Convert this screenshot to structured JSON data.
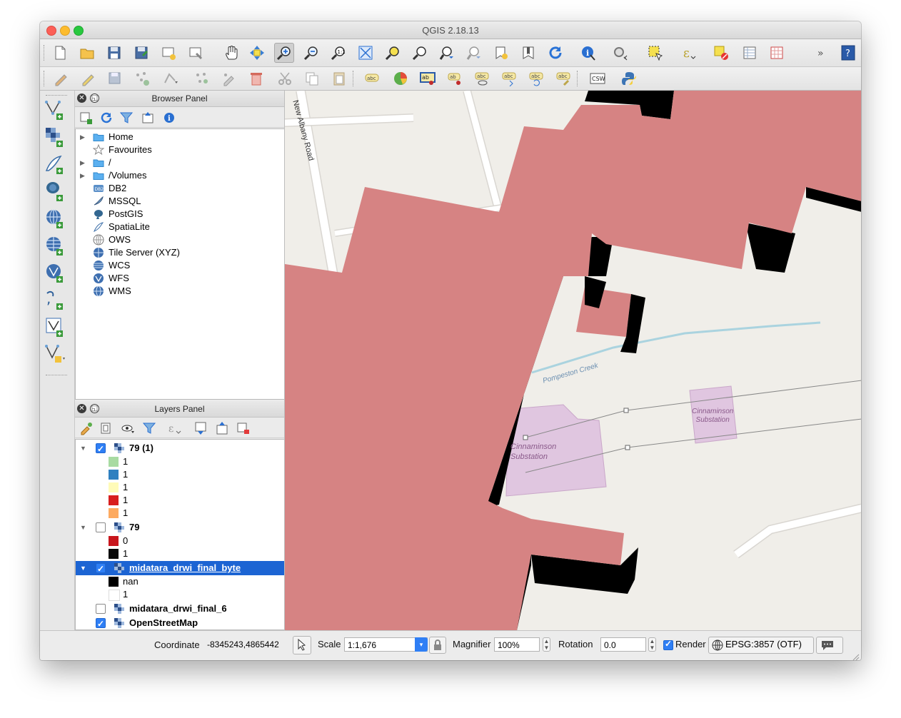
{
  "window": {
    "title": "QGIS 2.18.13"
  },
  "icons": {
    "toolbar1": [
      "new-project-icon",
      "open-project-icon",
      "save-project-icon",
      "save-as-icon",
      "new-print-composer-icon",
      "composer-manager-icon",
      "pan-icon",
      "pan-to-selection-icon",
      "zoom-in-icon",
      "zoom-out-icon",
      "zoom-native-icon",
      "zoom-full-icon",
      "zoom-to-selection-icon",
      "zoom-to-layer-icon",
      "zoom-last-icon",
      "zoom-next-icon",
      "new-bookmark-icon",
      "show-bookmarks-icon",
      "refresh-icon",
      "identify-icon",
      "run-action-icon",
      "select-features-icon",
      "field-calculator-icon",
      "deselect-icon",
      "attribute-table-icon",
      "statistics-icon",
      "overflow-chevron-icon",
      "help-icon"
    ],
    "toolbar2": [
      "current-edits-icon",
      "toggle-editing-icon",
      "save-edits-icon",
      "add-feature-icon",
      "move-feature-icon",
      "node-tool-icon",
      "digitize-icon",
      "delete-selected-icon",
      "cut-features-icon",
      "copy-features-icon",
      "paste-features-icon",
      "label-toolbar-icon",
      "layer-diagram-icon",
      "highlight-pinned-labels-icon",
      "pin-labels-icon",
      "show-hide-labels-icon",
      "move-label-icon",
      "rotate-label-icon",
      "change-label-icon",
      "csw-icon",
      "python-console-icon"
    ]
  },
  "left_toolbar": [
    "add-vector-layer-icon",
    "add-raster-layer-icon",
    "add-spatialite-layer-icon",
    "add-postgis-layer-icon",
    "add-wms-layer-icon",
    "add-wcs-layer-icon",
    "add-wfs-layer-icon",
    "add-delimited-text-icon",
    "add-virtual-layer-icon",
    "new-shapefile-icon"
  ],
  "browser_panel": {
    "title": "Browser Panel",
    "items": [
      {
        "label": "Home",
        "icon": "folder-icon",
        "expandable": true
      },
      {
        "label": "Favourites",
        "icon": "star-icon",
        "expandable": false
      },
      {
        "label": "/",
        "icon": "folder-icon",
        "expandable": true
      },
      {
        "label": "/Volumes",
        "icon": "folder-icon",
        "expandable": true
      },
      {
        "label": "DB2",
        "icon": "db2-icon",
        "expandable": false
      },
      {
        "label": "MSSQL",
        "icon": "mssql-icon",
        "expandable": false
      },
      {
        "label": "PostGIS",
        "icon": "postgis-icon",
        "expandable": false
      },
      {
        "label": "SpatiaLite",
        "icon": "spatialite-icon",
        "expandable": false
      },
      {
        "label": "OWS",
        "icon": "ows-icon",
        "expandable": false
      },
      {
        "label": "Tile Server (XYZ)",
        "icon": "xyz-icon",
        "expandable": false
      },
      {
        "label": "WCS",
        "icon": "wcs-icon",
        "expandable": false
      },
      {
        "label": "WFS",
        "icon": "wfs-icon",
        "expandable": false
      },
      {
        "label": "WMS",
        "icon": "wms-icon",
        "expandable": false
      }
    ]
  },
  "layers_panel": {
    "title": "Layers Panel",
    "layers": [
      {
        "name": "79 (1)",
        "checked": true,
        "expanded": true,
        "legend": [
          {
            "label": "1",
            "color": "#a8dba2"
          },
          {
            "label": "1",
            "color": "#2f80c0"
          },
          {
            "label": "1",
            "color": "#fffbb8"
          },
          {
            "label": "1",
            "color": "#d81e1e"
          },
          {
            "label": "1",
            "color": "#fdaa60"
          }
        ]
      },
      {
        "name": "79",
        "checked": false,
        "expanded": true,
        "legend": [
          {
            "label": "0",
            "color": "#c8161d"
          },
          {
            "label": "1",
            "color": "#0a0a0a"
          }
        ]
      },
      {
        "name": "midatara_drwi_final_byte",
        "checked": true,
        "expanded": true,
        "selected": true,
        "legend": [
          {
            "label": "nan",
            "color": "#000000"
          },
          {
            "label": "1",
            "color": "#ffffff"
          }
        ]
      },
      {
        "name": "midatara_drwi_final_6",
        "checked": false,
        "expanded": false
      },
      {
        "name": "OpenStreetMap",
        "checked": true,
        "expanded": false
      }
    ]
  },
  "map": {
    "labels": {
      "road": "New Albany Road",
      "creek": "Pompeston Creek",
      "substation_left": [
        "Cinnaminson",
        "Substation"
      ],
      "substation_right": [
        "Cinnaminson",
        "Substation"
      ]
    },
    "colors": {
      "background": "#f0eee9",
      "raster": "#d68383",
      "border": "#000000",
      "landuse": "#e0c6e0",
      "water": "#aad3df",
      "road": "#ffffff"
    }
  },
  "status": {
    "coordinate_label": "Coordinate",
    "coordinate_value": "-8345243,4865442",
    "scale_label": "Scale",
    "scale_value": "1:1,676",
    "magnifier_label": "Magnifier",
    "magnifier_value": "100%",
    "rotation_label": "Rotation",
    "rotation_value": "0.0",
    "render_label": "Render",
    "render_checked": true,
    "crs": "EPSG:3857 (OTF)"
  }
}
